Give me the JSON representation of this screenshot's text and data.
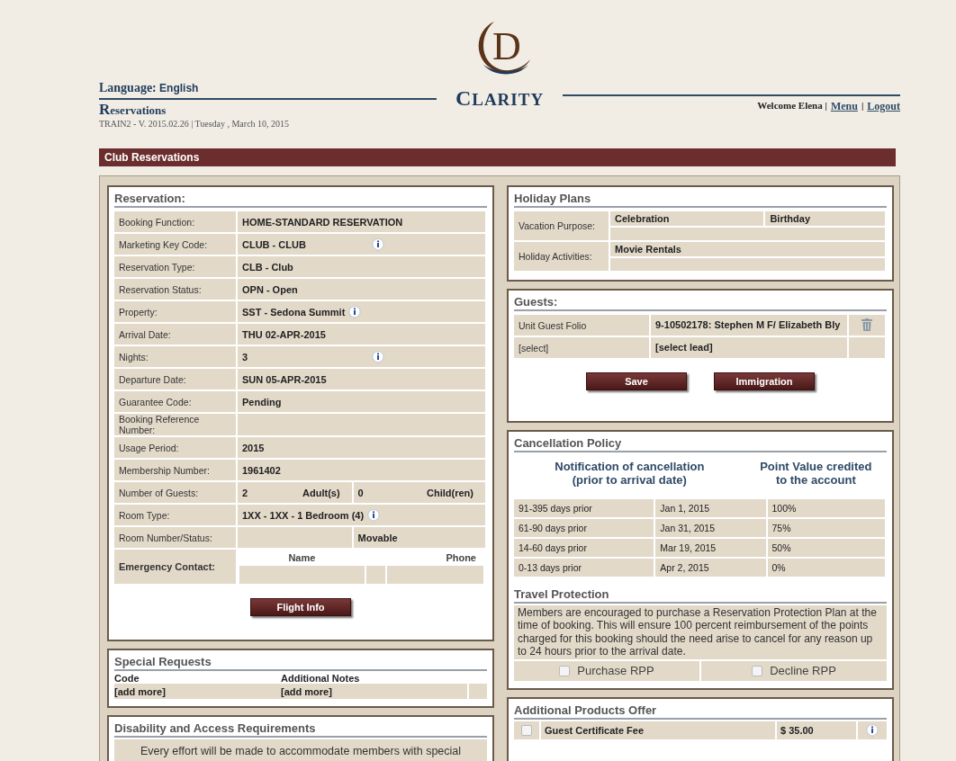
{
  "header": {
    "language_label": "Language:",
    "language": "English",
    "module": "Reservations",
    "version": "TRAIN2 - V. 2015.02.26 | Tuesday , March 10, 2015",
    "logo_mark": "D",
    "logo_name": "CLARITY",
    "welcome": "Welcome Elena |",
    "links": [
      "Menu",
      "Logout"
    ],
    "link_separator": "|"
  },
  "title_bar": "Club Reservations",
  "reservation": {
    "title": "Reservation:",
    "rows": [
      {
        "kind": "text",
        "label": "Booking Function:",
        "value": "HOME-STANDARD RESERVATION",
        "info_button": false
      },
      {
        "kind": "text",
        "label": "Marketing Key Code:",
        "value": "CLUB - CLUB",
        "info_button": true
      },
      {
        "kind": "text",
        "label": "Reservation Type:",
        "value": "CLB - Club",
        "info_button": false
      },
      {
        "kind": "text",
        "label": "Reservation Status:",
        "value": "OPN - Open",
        "info_button": false
      },
      {
        "kind": "inline",
        "label": "Property:",
        "value": "SST - Sedona Summit",
        "info_button": true
      },
      {
        "kind": "text",
        "label": "Arrival Date:",
        "value": "THU 02-APR-2015",
        "info_button": false
      },
      {
        "kind": "text",
        "label": "Nights:",
        "value": "3",
        "info_button": true
      },
      {
        "kind": "text",
        "label": "Departure Date:",
        "value": "SUN 05-APR-2015",
        "info_button": false
      },
      {
        "kind": "text",
        "label": "Guarantee Code:",
        "value": "Pending",
        "info_button": false
      },
      {
        "kind": "text",
        "label": "Booking Reference Number:",
        "value": "",
        "info_button": false
      },
      {
        "kind": "text",
        "label": "Usage Period:",
        "value": "2015",
        "info_button": false
      },
      {
        "kind": "text",
        "label": "Membership Number:",
        "value": "1961402",
        "info_button": false
      },
      {
        "kind": "guests",
        "label": "Number of Guests:",
        "adults": "2",
        "adults_label": "Adult(s)",
        "children": "0",
        "children_label": "Child(ren)"
      },
      {
        "kind": "inline",
        "label": "Room Type:",
        "value": "1XX - 1XX - 1 Bedroom (4)",
        "info_button": true
      },
      {
        "kind": "split",
        "label": "Room Number/Status:",
        "status": "Movable"
      },
      {
        "kind": "contact",
        "label": "Emergency Contact:",
        "name_header": "Name",
        "phone_header": "Phone"
      }
    ],
    "button": "Flight Info"
  },
  "special_requests": {
    "title": "Special Requests",
    "columns": [
      "Code",
      "Additional Notes"
    ],
    "links": [
      "[add more]",
      "[add more]"
    ]
  },
  "disability": {
    "title": "Disability and Access Requirements",
    "text": "Every effort will be made to accommodate members with special"
  },
  "holiday_plans": {
    "title": "Holiday Plans",
    "rows": [
      {
        "label": "Vacation Purpose:",
        "values": [
          "Celebration",
          "Birthday"
        ]
      },
      {
        "label": "Holiday Activities:",
        "values": [
          "Movie Rentals"
        ]
      }
    ]
  },
  "guests": {
    "title": "Guests:",
    "rows": [
      {
        "label": "Unit Guest Folio",
        "value": "9-10502178: Stephen M F/ Elizabeth Bly",
        "delete_button": true
      },
      {
        "label": "[select]",
        "value": "[select lead]",
        "delete_button": false
      }
    ],
    "buttons": [
      "Save",
      "Immigration"
    ]
  },
  "cancellation": {
    "title": "Cancellation Policy",
    "headers": [
      "Notification of cancellation (prior to arrival date)",
      "Point Value credited to the account"
    ],
    "rows": [
      [
        "91-395 days prior",
        "Jan 1, 2015",
        "100%"
      ],
      [
        "61-90 days prior",
        "Jan 31, 2015",
        "75%"
      ],
      [
        "14-60 days prior",
        "Mar 19, 2015",
        "50%"
      ],
      [
        "0-13 days prior",
        "Apr 2, 2015",
        "0%"
      ]
    ]
  },
  "travel_protection": {
    "title": "Travel Protection",
    "text": "Members are encouraged to purchase a Reservation Protection Plan at the time of booking. This will ensure 100 percent reimbursement of the points charged for this booking should the need arise to cancel for any reason up to 24 hours prior to the arrival date.",
    "options": [
      {
        "label": "Purchase RPP",
        "checked": false
      },
      {
        "label": "Decline RPP",
        "checked": false
      }
    ]
  },
  "additional_products": {
    "title": "Additional Products Offer",
    "rows": [
      {
        "name": "Guest Certificate Fee",
        "price": "$ 35.00",
        "checked": false
      }
    ]
  }
}
